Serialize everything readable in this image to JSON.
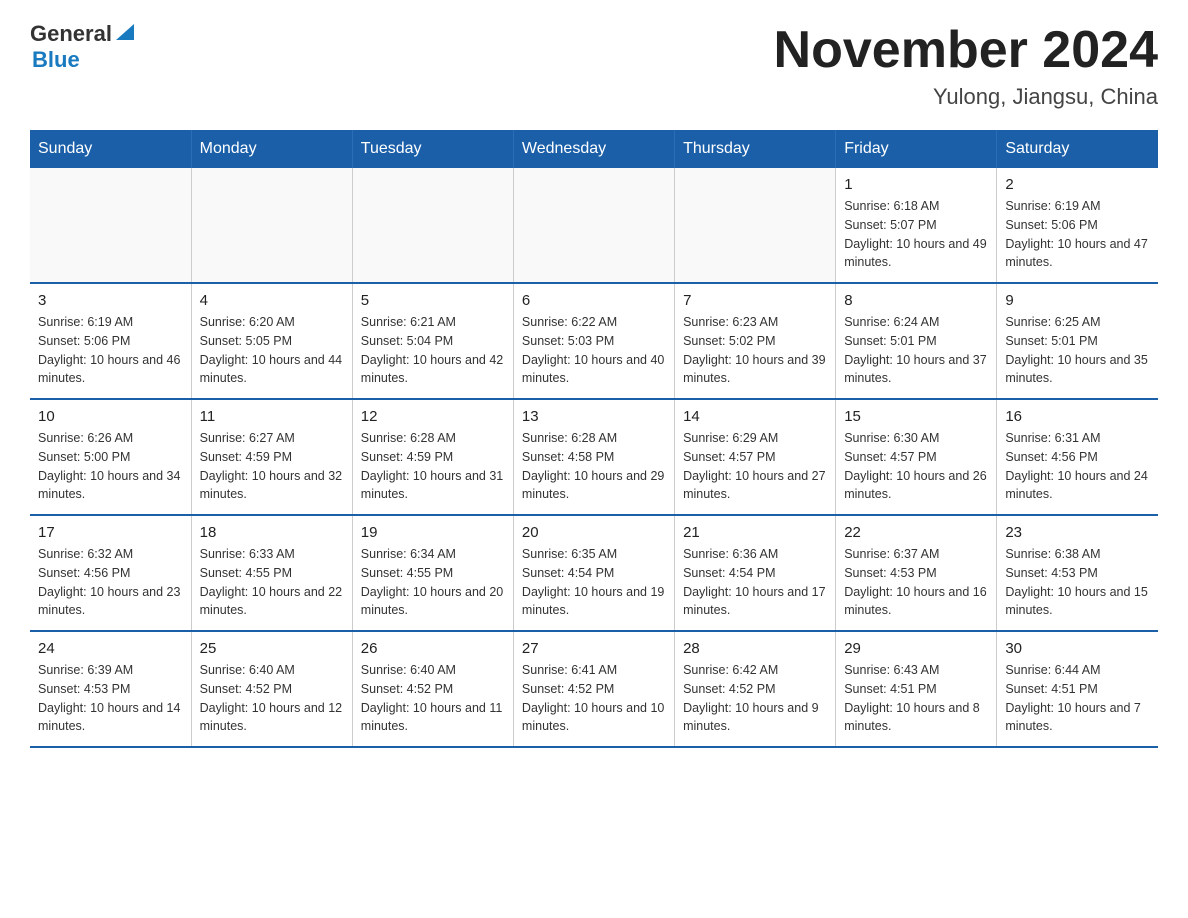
{
  "header": {
    "logo_general": "General",
    "logo_blue": "Blue",
    "month_title": "November 2024",
    "location": "Yulong, Jiangsu, China"
  },
  "days_of_week": [
    "Sunday",
    "Monday",
    "Tuesday",
    "Wednesday",
    "Thursday",
    "Friday",
    "Saturday"
  ],
  "weeks": [
    [
      {
        "day": "",
        "info": ""
      },
      {
        "day": "",
        "info": ""
      },
      {
        "day": "",
        "info": ""
      },
      {
        "day": "",
        "info": ""
      },
      {
        "day": "",
        "info": ""
      },
      {
        "day": "1",
        "info": "Sunrise: 6:18 AM\nSunset: 5:07 PM\nDaylight: 10 hours and 49 minutes."
      },
      {
        "day": "2",
        "info": "Sunrise: 6:19 AM\nSunset: 5:06 PM\nDaylight: 10 hours and 47 minutes."
      }
    ],
    [
      {
        "day": "3",
        "info": "Sunrise: 6:19 AM\nSunset: 5:06 PM\nDaylight: 10 hours and 46 minutes."
      },
      {
        "day": "4",
        "info": "Sunrise: 6:20 AM\nSunset: 5:05 PM\nDaylight: 10 hours and 44 minutes."
      },
      {
        "day": "5",
        "info": "Sunrise: 6:21 AM\nSunset: 5:04 PM\nDaylight: 10 hours and 42 minutes."
      },
      {
        "day": "6",
        "info": "Sunrise: 6:22 AM\nSunset: 5:03 PM\nDaylight: 10 hours and 40 minutes."
      },
      {
        "day": "7",
        "info": "Sunrise: 6:23 AM\nSunset: 5:02 PM\nDaylight: 10 hours and 39 minutes."
      },
      {
        "day": "8",
        "info": "Sunrise: 6:24 AM\nSunset: 5:01 PM\nDaylight: 10 hours and 37 minutes."
      },
      {
        "day": "9",
        "info": "Sunrise: 6:25 AM\nSunset: 5:01 PM\nDaylight: 10 hours and 35 minutes."
      }
    ],
    [
      {
        "day": "10",
        "info": "Sunrise: 6:26 AM\nSunset: 5:00 PM\nDaylight: 10 hours and 34 minutes."
      },
      {
        "day": "11",
        "info": "Sunrise: 6:27 AM\nSunset: 4:59 PM\nDaylight: 10 hours and 32 minutes."
      },
      {
        "day": "12",
        "info": "Sunrise: 6:28 AM\nSunset: 4:59 PM\nDaylight: 10 hours and 31 minutes."
      },
      {
        "day": "13",
        "info": "Sunrise: 6:28 AM\nSunset: 4:58 PM\nDaylight: 10 hours and 29 minutes."
      },
      {
        "day": "14",
        "info": "Sunrise: 6:29 AM\nSunset: 4:57 PM\nDaylight: 10 hours and 27 minutes."
      },
      {
        "day": "15",
        "info": "Sunrise: 6:30 AM\nSunset: 4:57 PM\nDaylight: 10 hours and 26 minutes."
      },
      {
        "day": "16",
        "info": "Sunrise: 6:31 AM\nSunset: 4:56 PM\nDaylight: 10 hours and 24 minutes."
      }
    ],
    [
      {
        "day": "17",
        "info": "Sunrise: 6:32 AM\nSunset: 4:56 PM\nDaylight: 10 hours and 23 minutes."
      },
      {
        "day": "18",
        "info": "Sunrise: 6:33 AM\nSunset: 4:55 PM\nDaylight: 10 hours and 22 minutes."
      },
      {
        "day": "19",
        "info": "Sunrise: 6:34 AM\nSunset: 4:55 PM\nDaylight: 10 hours and 20 minutes."
      },
      {
        "day": "20",
        "info": "Sunrise: 6:35 AM\nSunset: 4:54 PM\nDaylight: 10 hours and 19 minutes."
      },
      {
        "day": "21",
        "info": "Sunrise: 6:36 AM\nSunset: 4:54 PM\nDaylight: 10 hours and 17 minutes."
      },
      {
        "day": "22",
        "info": "Sunrise: 6:37 AM\nSunset: 4:53 PM\nDaylight: 10 hours and 16 minutes."
      },
      {
        "day": "23",
        "info": "Sunrise: 6:38 AM\nSunset: 4:53 PM\nDaylight: 10 hours and 15 minutes."
      }
    ],
    [
      {
        "day": "24",
        "info": "Sunrise: 6:39 AM\nSunset: 4:53 PM\nDaylight: 10 hours and 14 minutes."
      },
      {
        "day": "25",
        "info": "Sunrise: 6:40 AM\nSunset: 4:52 PM\nDaylight: 10 hours and 12 minutes."
      },
      {
        "day": "26",
        "info": "Sunrise: 6:40 AM\nSunset: 4:52 PM\nDaylight: 10 hours and 11 minutes."
      },
      {
        "day": "27",
        "info": "Sunrise: 6:41 AM\nSunset: 4:52 PM\nDaylight: 10 hours and 10 minutes."
      },
      {
        "day": "28",
        "info": "Sunrise: 6:42 AM\nSunset: 4:52 PM\nDaylight: 10 hours and 9 minutes."
      },
      {
        "day": "29",
        "info": "Sunrise: 6:43 AM\nSunset: 4:51 PM\nDaylight: 10 hours and 8 minutes."
      },
      {
        "day": "30",
        "info": "Sunrise: 6:44 AM\nSunset: 4:51 PM\nDaylight: 10 hours and 7 minutes."
      }
    ]
  ]
}
